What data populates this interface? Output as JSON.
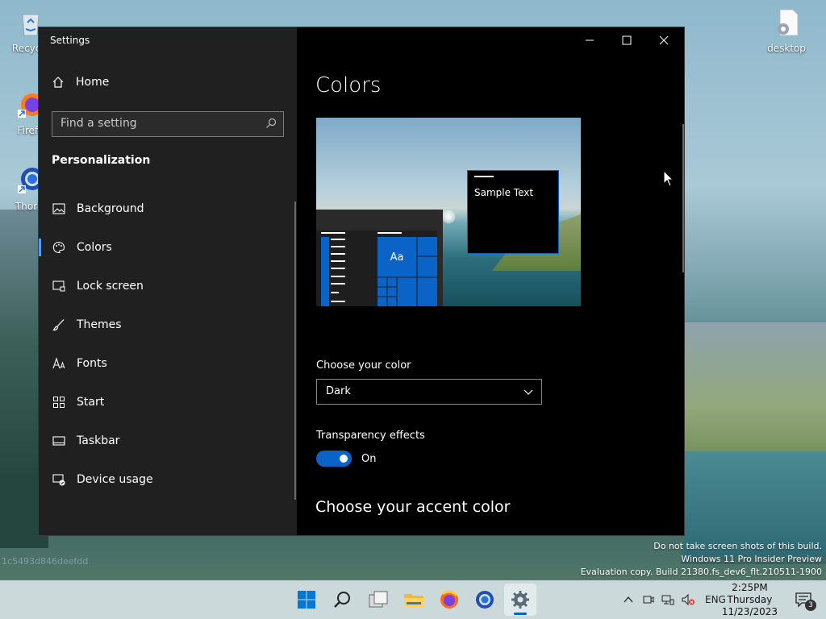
{
  "window": {
    "title": "Settings",
    "minimize_label": "—",
    "maximize_label": "☐",
    "close_label": "✕"
  },
  "sidebar": {
    "home_label": "Home",
    "search_placeholder": "Find a setting",
    "section_title": "Personalization",
    "items": [
      {
        "label": "Background",
        "icon": "image-icon",
        "selected": false
      },
      {
        "label": "Colors",
        "icon": "palette-icon",
        "selected": true
      },
      {
        "label": "Lock screen",
        "icon": "lock-screen-icon",
        "selected": false
      },
      {
        "label": "Themes",
        "icon": "brush-icon",
        "selected": false
      },
      {
        "label": "Fonts",
        "icon": "font-icon",
        "selected": false
      },
      {
        "label": "Start",
        "icon": "start-grid-icon",
        "selected": false
      },
      {
        "label": "Taskbar",
        "icon": "taskbar-icon",
        "selected": false
      },
      {
        "label": "Device usage",
        "icon": "device-usage-icon",
        "selected": false
      }
    ]
  },
  "main": {
    "page_title": "Colors",
    "preview": {
      "sample_text": "Sample Text",
      "tile_label": "Aa"
    },
    "choose_color_label": "Choose your color",
    "choose_color_value": "Dark",
    "transparency_label": "Transparency effects",
    "transparency_state": "On",
    "accent_title": "Choose your accent color"
  },
  "desktop": {
    "icons": [
      {
        "label": "Recycle",
        "icon": "recycle-bin-icon"
      },
      {
        "label": "Firefo",
        "icon": "firefox-icon"
      },
      {
        "label": "Thoriu",
        "icon": "thorium-icon"
      },
      {
        "label": "desktop",
        "icon": "settings-file-icon"
      }
    ],
    "hash_text": "1c5493d846deefdd",
    "watermark": [
      "Do not take screen shots of this build.",
      "Windows 11 Pro Insider Preview",
      "Evaluation copy. Build 21380.fs_dev6_flt.210511-1900"
    ]
  },
  "taskbar": {
    "apps": [
      "start-icon",
      "search-icon",
      "task-view-icon",
      "file-explorer-icon",
      "firefox-icon",
      "thorium-icon",
      "settings-icon"
    ],
    "language": "ENG",
    "time": "2:25PM",
    "day": "Thursday",
    "date": "11/23/2023",
    "notification_count": "3"
  },
  "colors": {
    "accent": "#0a64c8",
    "selection_indicator": "#4c9eff",
    "sidebar_bg": "#202020",
    "content_bg": "#000000"
  }
}
